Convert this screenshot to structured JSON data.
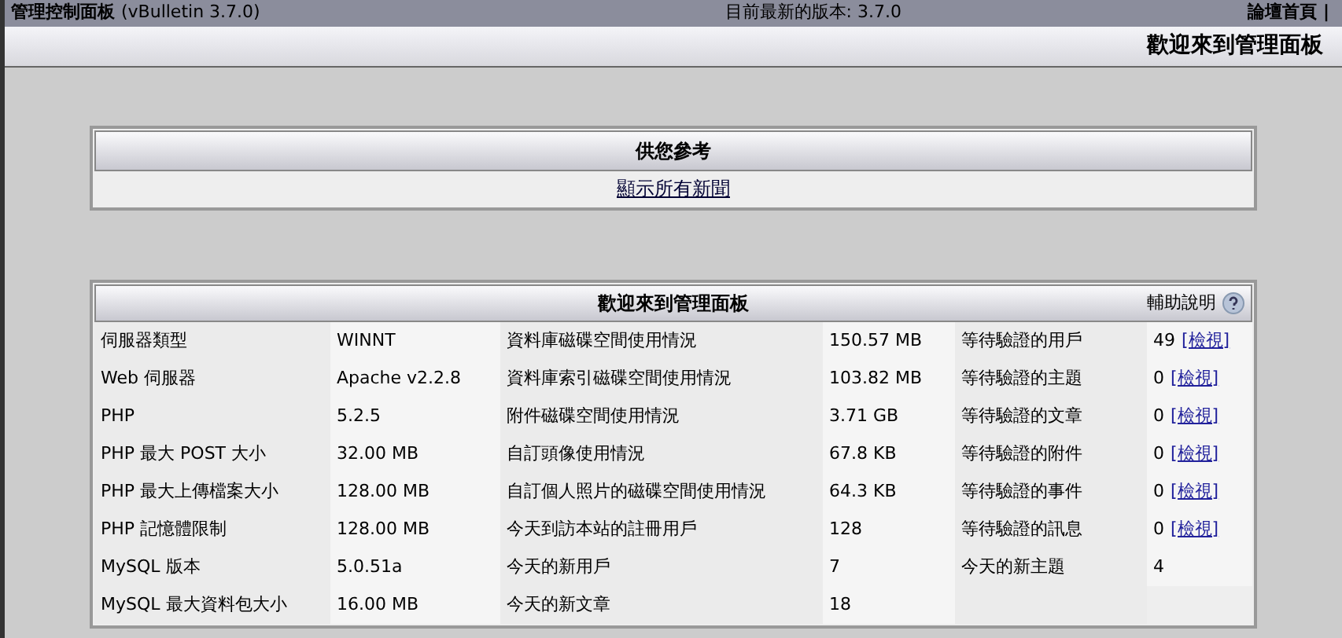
{
  "top_bar": {
    "title": "管理控制面板",
    "version": "(vBulletin 3.7.0)",
    "latest": "目前最新的版本: 3.7.0",
    "home_link": "論壇首頁",
    "separator": "|"
  },
  "header": {
    "title": "歡迎來到管理面板"
  },
  "news_panel": {
    "title": "供您參考",
    "link": "顯示所有新聞"
  },
  "welcome_panel": {
    "title": "歡迎來到管理面板",
    "help": "輔助說明",
    "rows": [
      {
        "label": "伺服器類型",
        "value": "WINNT",
        "label2": "資料庫磁碟空間使用情況",
        "value2": "150.57 MB",
        "label3": "等待驗證的用戶",
        "value3": "49",
        "link": "[檢視]"
      },
      {
        "label": "Web 伺服器",
        "value": "Apache v2.2.8",
        "label2": "資料庫索引磁碟空間使用情況",
        "value2": "103.82 MB",
        "label3": "等待驗證的主題",
        "value3": "0",
        "link": "[檢視]"
      },
      {
        "label": "PHP",
        "value": "5.2.5",
        "label2": "附件磁碟空間使用情況",
        "value2": "3.71 GB",
        "label3": "等待驗證的文章",
        "value3": "0",
        "link": "[檢視]"
      },
      {
        "label": "PHP 最大 POST 大小",
        "value": "32.00 MB",
        "label2": "自訂頭像使用情況",
        "value2": "67.8 KB",
        "label3": "等待驗證的附件",
        "value3": "0",
        "link": "[檢視]"
      },
      {
        "label": "PHP 最大上傳檔案大小",
        "value": "128.00 MB",
        "label2": "自訂個人照片的磁碟空間使用情況",
        "value2": "64.3 KB",
        "label3": "等待驗證的事件",
        "value3": "0",
        "link": "[檢視]"
      },
      {
        "label": "PHP 記憶體限制",
        "value": "128.00 MB",
        "label2": "今天到訪本站的註冊用戶",
        "value2": "128",
        "label3": "等待驗證的訊息",
        "value3": "0",
        "link": "[檢視]"
      },
      {
        "label": "MySQL 版本",
        "value": "5.0.51a",
        "label2": "今天的新用戶",
        "value2": "7",
        "label3": "今天的新主題",
        "value3": "4"
      },
      {
        "label": "MySQL 最大資料包大小",
        "value": "16.00 MB",
        "label2": "今天的新文章",
        "value2": "18"
      }
    ]
  }
}
